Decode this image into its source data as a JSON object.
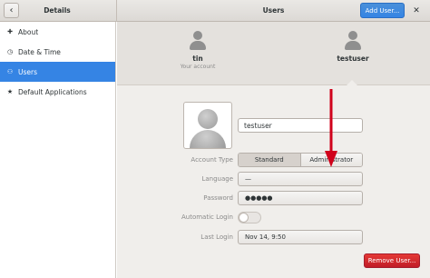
{
  "header": {
    "back_icon": "chevron-left-icon",
    "details_title": "Details",
    "users_title": "Users",
    "add_user_label": "Add User...",
    "close_icon": "close-icon"
  },
  "sidebar": {
    "items": [
      {
        "label": "About",
        "icon": "plus-icon",
        "glyph": "✚"
      },
      {
        "label": "Date & Time",
        "icon": "clock-icon",
        "glyph": "◷"
      },
      {
        "label": "Users",
        "icon": "users-icon",
        "glyph": "👥"
      },
      {
        "label": "Default Applications",
        "icon": "star-icon",
        "glyph": "★"
      }
    ],
    "active_index": 2
  },
  "carousel": {
    "users": [
      {
        "name": "tin",
        "subtitle": "Your account"
      },
      {
        "name": "testuser",
        "subtitle": ""
      }
    ]
  },
  "account": {
    "name_value": "testuser",
    "account_type_label": "Account Type",
    "standard_label": "Standard",
    "administrator_label": "Administrator",
    "language_label": "Language",
    "language_value": "—",
    "password_label": "Password",
    "password_value": "●●●●●",
    "auto_login_label": "Automatic Login",
    "auto_login_on": false,
    "last_login_label": "Last Login",
    "last_login_value": "Nov 14,  9:50",
    "remove_user_label": "Remove User..."
  },
  "colors": {
    "accent": "#3584e4",
    "destructive": "#c01c28",
    "annotation_arrow": "#d0021b"
  }
}
